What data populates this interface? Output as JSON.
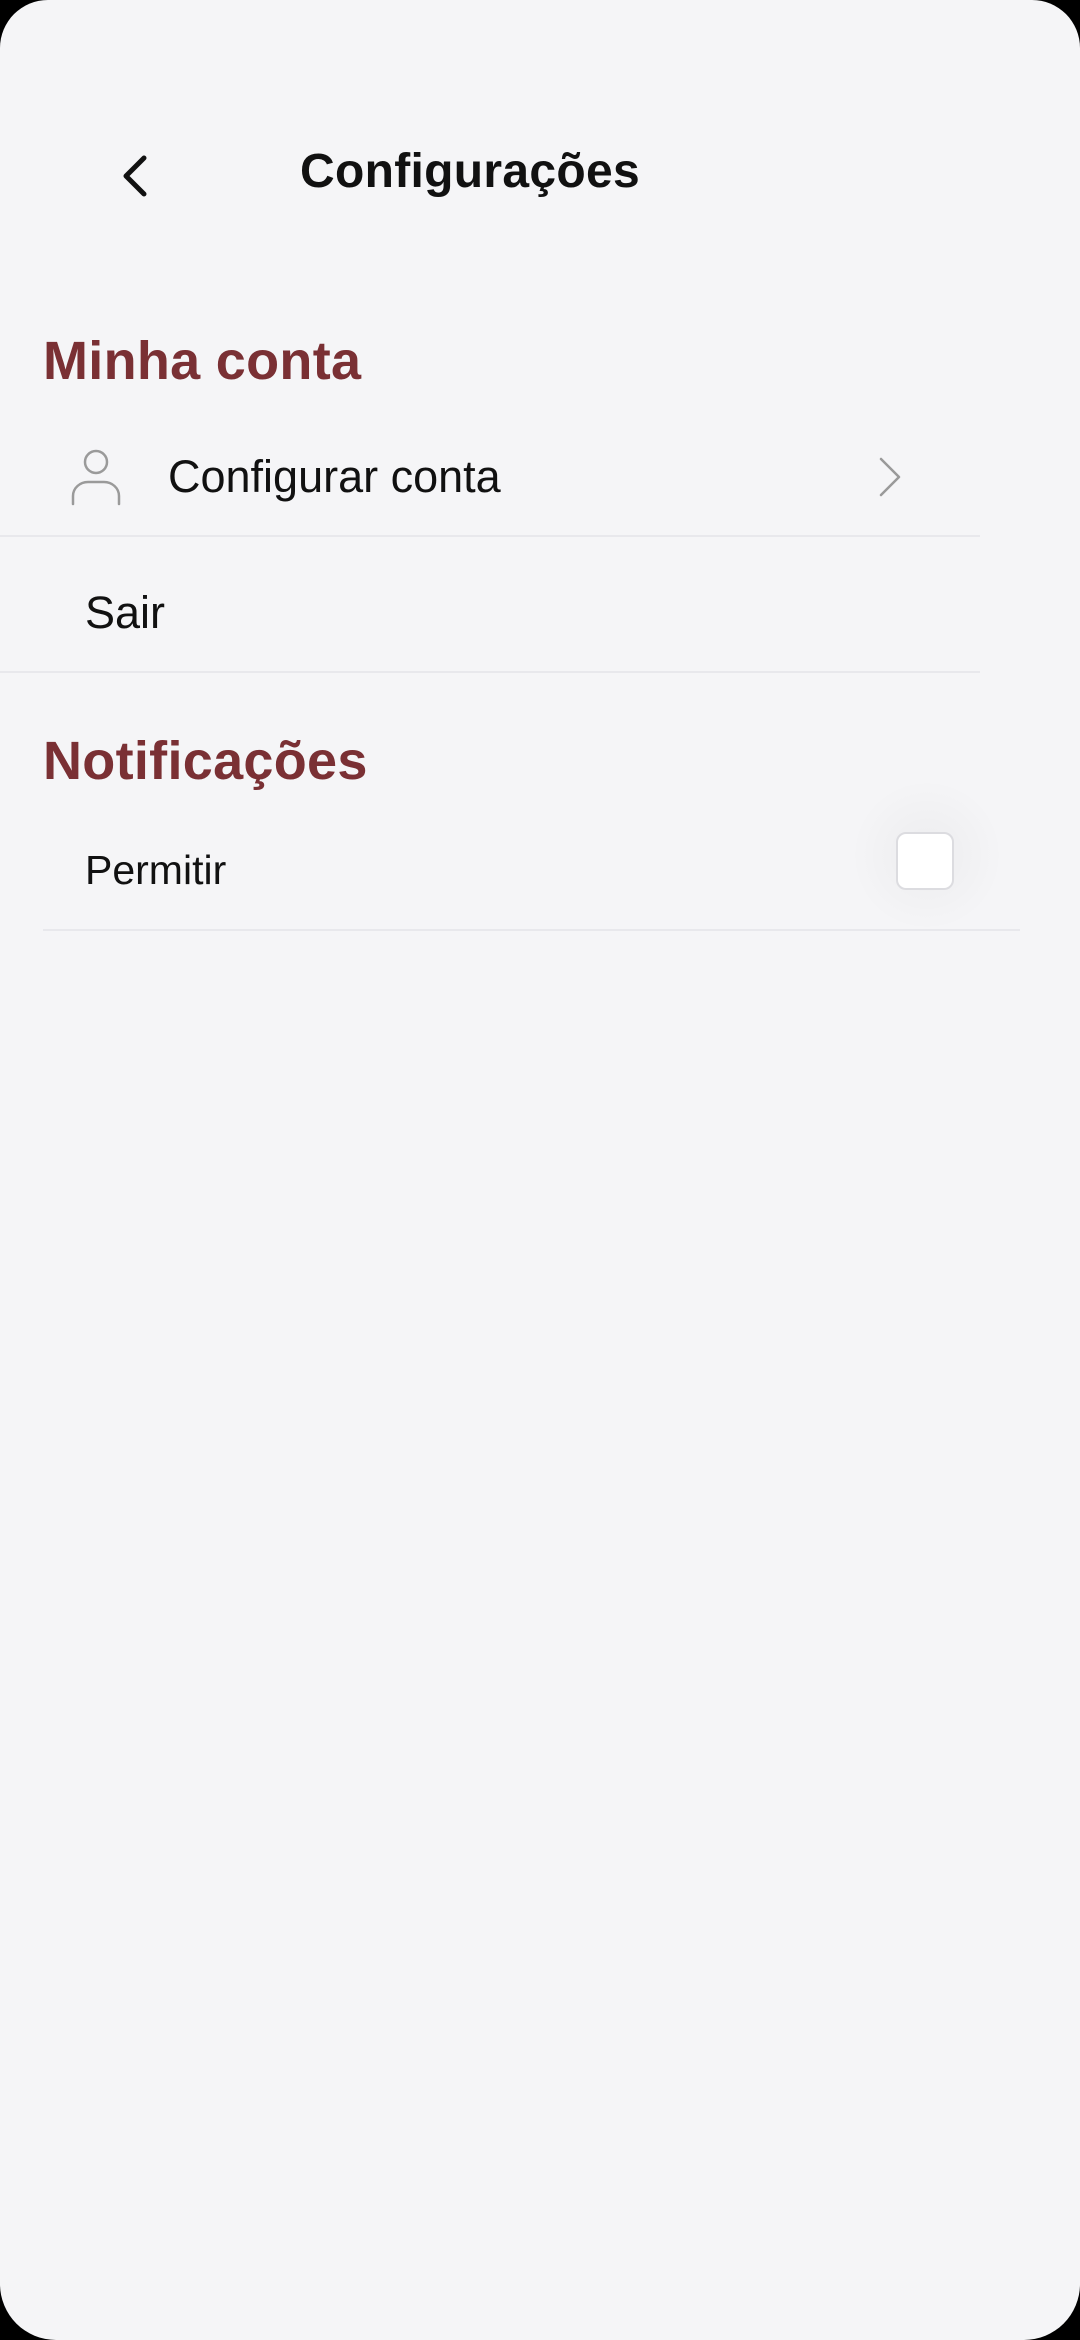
{
  "header": {
    "title": "Configurações",
    "back_icon": "chevron-left-icon"
  },
  "account": {
    "title": "Minha conta",
    "configure_label": "Configurar conta",
    "configure_icon": "user-icon",
    "logout_label": "Sair"
  },
  "notifications": {
    "title": "Notificações",
    "allow_label": "Permitir",
    "allow_checked": false
  },
  "colors": {
    "accent": "#7a3034",
    "background": "#f5f5f7",
    "text": "#111111",
    "icon": "#9a9a9a"
  }
}
